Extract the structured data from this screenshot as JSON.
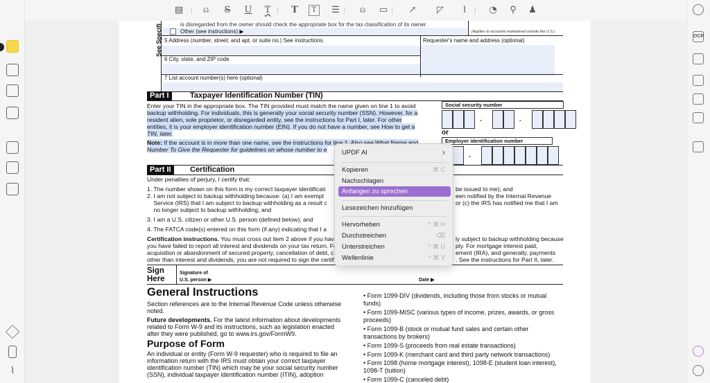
{
  "toolbar": {
    "icons": [
      "comment-icon",
      "highlight-icon",
      "strikethrough-icon",
      "underline-icon",
      "squiggly-icon",
      "text-icon",
      "textbox-icon",
      "text-callout-icon",
      "pencil-icon",
      "eraser-icon",
      "arrow-icon",
      "shape-icon",
      "attachment-icon",
      "sticker-icon",
      "stamp-icon",
      "signature-icon"
    ],
    "glyphs": [
      "▤",
      "⍝",
      "S",
      "U",
      "T",
      "T",
      "T",
      "☰",
      "⍝",
      "▭",
      "↗",
      "◸",
      "⌇",
      "◔",
      "⚲",
      "♟"
    ]
  },
  "left_sidebar": {
    "items": [
      "comment-mode",
      "edit-pdf",
      "reader",
      "fill-sign",
      "organize-pages",
      "crop",
      "page-tools",
      "layers",
      "bookmark",
      "attachments"
    ]
  },
  "right_sidebar": {
    "items": [
      "search",
      "ocr",
      "convert",
      "protect",
      "share",
      "email",
      "save",
      "ai-assistant",
      "chat"
    ],
    "ocr_label": "OCR"
  },
  "form": {
    "top_line": "is disregarded from the owner should check the appropriate box for the tax classification of its owner.",
    "other": "Other (see instructions) ▶",
    "applies": "(Applies to accounts maintained outside the U.S.)",
    "side_label": "See Specifi",
    "line5": "5  Address (number, street, and apt. or suite no.) See instructions.",
    "requester": "Requester's name and address (optional)",
    "line6": "6  City, state, and ZIP code",
    "line7": "7  List account number(s) here (optional)",
    "part1_label": "Part I",
    "part1_title": "Taxpayer Identification Number (TIN)",
    "part1_lines": [
      "Enter your TIN in the appropriate box. The TIN provided must match the name given on line 1 to avoid",
      "backup withholding. For individuals, this is generally your social security number (SSN). However, for a",
      "resident alien, sole proprietor, or disregarded entity, see the instructions for Part I, later. For other",
      "entities, it is your employer identification number (EIN). If you do not have a number, see How to get a",
      "TIN, later."
    ],
    "note_bold": "Note:",
    "note_lines": [
      " If the account is in more than one name, see the instructions for line 1. Also see What Name and",
      "Number To Give the Requester for guidelines on whose number to e"
    ],
    "ssn_label": "Social security number",
    "or": "or",
    "ein_label": "Employer identification number",
    "dash": "-",
    "part2_label": "Part II",
    "part2_title": "Certification",
    "cert_intro": "Under penalties of perjury, I certify that:",
    "cert_lines": [
      "1. The number shown on this form is my correct taxpayer identificati",
      "2. I am not subject to backup withholding because: (a) I am exempt",
      "    Service (IRS) that I am subject to backup withholding as a result c",
      "    no longer subject to backup withholding; and",
      "3. I am a U.S. citizen or other U.S. person (defined below); and",
      "4. The FATCA code(s) entered on this form (if any) indicating that I a"
    ],
    "cert_right": [
      "be issued to me); and",
      "een notified by the Internal Revenue",
      "or (c) the IRS has notified me that I am"
    ],
    "ci_bold": "Certification instructions.",
    "ci_lines": [
      " You must cross out item 2 above if you hav",
      "you have failed to report all interest and dividends on your tax return. Fo",
      "acquisition or abandonment of secured property, cancellation of debt, c",
      "other than interest and dividends, you are not required to sign the certifi"
    ],
    "ci_right": [
      "ly subject to backup withholding because",
      "ply. For mortgage interest paid,",
      "ement (IRA), and generally, payments",
      ". See the instructions for Part II, later."
    ],
    "sign": "Sign",
    "here": "Here",
    "sig_of": "Signature of",
    "us_person": "U.S. person ▶",
    "date": "Date ▶",
    "gi_title": "General Instructions",
    "gi_text": [
      "Section references are to the Internal Revenue Code unless otherwise",
      "noted."
    ],
    "fd_bold": "Future developments.",
    "fd_lines": [
      " For the latest information about developments",
      "related to Form W-9 and its instructions, such as legislation enacted",
      "after they were published, go to www.irs.gov/FormW9."
    ],
    "pf_title": "Purpose of Form",
    "pf_lines": [
      "An individual or entity (Form W-9 requester) who is required to file an",
      "information return with the IRS must obtain your correct taxpayer",
      "identification number (TIN) which may be your social security number",
      "(SSN), individual taxpayer identification number (ITIN), adoption"
    ],
    "bullets": [
      "• Form 1099-DIV (dividends, including those from stocks or mutual",
      "funds)",
      "• Form 1099-MISC (various types of income, prizes, awards, or gross",
      "proceeds)",
      "• Form 1099-B (stock or mutual fund sales and certain other",
      "transactions by brokers)",
      "• Form 1099-S (proceeds from real estate transactions)",
      "• Form 1099-K (merchant card and third party network transactions)",
      "• Form 1098 (home mortgage interest), 1098-E (student loan interest),",
      "1098-T (tuition)",
      "• Form 1099-C (canceled debt)"
    ]
  },
  "context_menu": {
    "items": [
      {
        "label": "UPDF AI",
        "shortcut": "›"
      },
      {
        "label": "Kopieren",
        "shortcut": "⌘ C"
      },
      {
        "label": "Nachschlagen",
        "shortcut": ""
      },
      {
        "label": "Anfangen zu sprechen",
        "shortcut": ""
      },
      {
        "label": "Lesezeichen hinzufügen",
        "shortcut": ""
      },
      {
        "label": "Hervorheben",
        "shortcut": "^ ⌘ H"
      },
      {
        "label": "Durchstreichen",
        "shortcut": "⌫"
      },
      {
        "label": "Unterstreichen",
        "shortcut": "^ ⌘ U"
      },
      {
        "label": "Wellenlinie",
        "shortcut": "^ ⌘ V"
      }
    ],
    "selected": "Anfangen zu sprechen",
    "accent": "#9c6fcf"
  }
}
